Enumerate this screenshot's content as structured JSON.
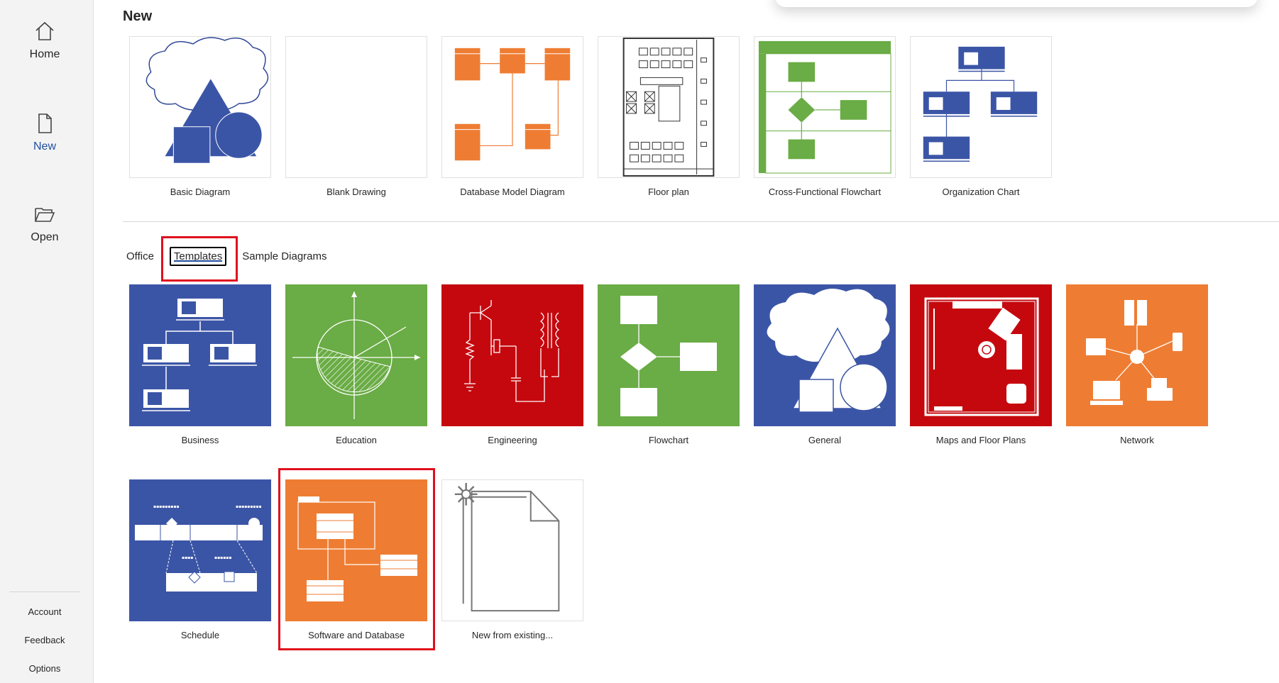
{
  "sidebar": {
    "nav": [
      {
        "label": "Home",
        "icon": "home-icon"
      },
      {
        "label": "New",
        "icon": "new-document-icon"
      },
      {
        "label": "Open",
        "icon": "open-folder-icon"
      }
    ],
    "bottom_links": [
      "Account",
      "Feedback",
      "Options"
    ]
  },
  "main": {
    "title": "New",
    "featured": [
      {
        "label": "Basic Diagram"
      },
      {
        "label": "Blank Drawing"
      },
      {
        "label": "Database Model Diagram"
      },
      {
        "label": "Floor plan"
      },
      {
        "label": "Cross-Functional Flowchart"
      },
      {
        "label": "Organization Chart"
      }
    ],
    "tabs": [
      "Office",
      "Templates",
      "Sample Diagrams"
    ],
    "active_tab": "Templates",
    "templates": [
      {
        "label": "Business",
        "color": "#3b55a6"
      },
      {
        "label": "Education",
        "color": "#6aac45"
      },
      {
        "label": "Engineering",
        "color": "#c5080e"
      },
      {
        "label": "Flowchart",
        "color": "#6aac45"
      },
      {
        "label": "General",
        "color": "#3b55a6"
      },
      {
        "label": "Maps and Floor Plans",
        "color": "#c5080e"
      },
      {
        "label": "Network",
        "color": "#ee7d33"
      },
      {
        "label": "Schedule",
        "color": "#3b55a6"
      },
      {
        "label": "Software and Database",
        "color": "#ee7d33"
      },
      {
        "label": "New from existing..."
      }
    ]
  },
  "colors": {
    "accent": "#1f4e9e",
    "highlight": "#e0101c",
    "orange": "#ee7d33",
    "blue": "#3b55a6",
    "green": "#6aac45",
    "red": "#c5080e"
  }
}
